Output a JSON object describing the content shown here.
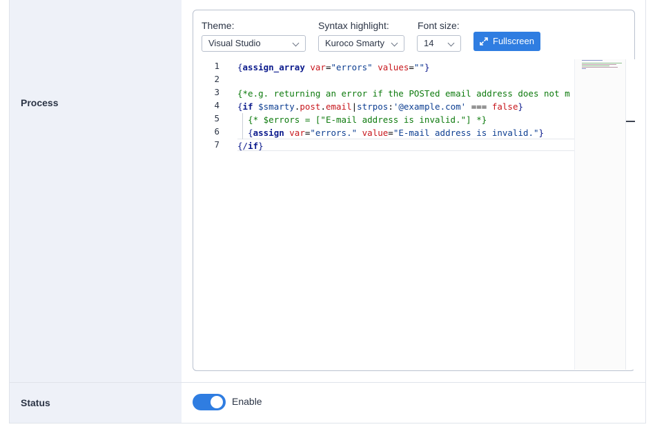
{
  "rows": {
    "process_label": "Process",
    "status_label": "Status"
  },
  "editor": {
    "theme": {
      "label": "Theme:",
      "value": "Visual Studio"
    },
    "syntax": {
      "label": "Syntax highlight:",
      "value": "Kuroco Smarty"
    },
    "font_size": {
      "label": "Font size:",
      "value": "14"
    },
    "fullscreen_label": "Fullscreen",
    "line_numbers": [
      "1",
      "2",
      "3",
      "4",
      "5",
      "6",
      "7"
    ],
    "code_lines": [
      "{assign_array var=\"errors\" values=\"\"}",
      "",
      "{*e.g. returning an error if the POSTed email address does not m",
      "{if $smarty.post.email|strpos:'@example.com' === false}",
      "  {* $errors = [\"E-mail address is invalid.\"] *}",
      "  {assign var=\"errors.\" value=\"E-mail address is invalid.\"}",
      "{/if}"
    ]
  },
  "status": {
    "toggle_on": true,
    "toggle_label": "Enable"
  },
  "colors": {
    "accent": "#2f7de1",
    "label_background": "#eef1f8",
    "code_keyword": "#0b1a8c",
    "code_attribute": "#c7161c",
    "code_string": "#0d3e91",
    "code_comment": "#0d7a0d"
  },
  "icons": {
    "fullscreen": "expand-arrows-icon",
    "select_chevron": "chevron-down-icon"
  }
}
